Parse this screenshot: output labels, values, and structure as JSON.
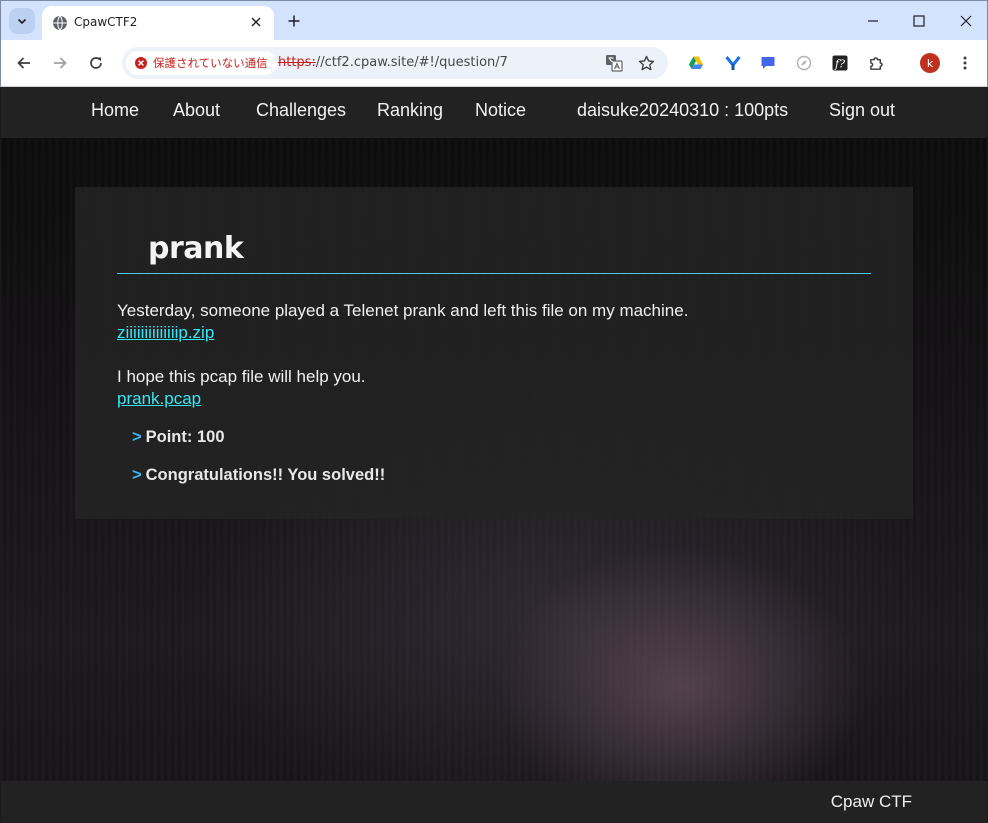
{
  "browser": {
    "tab_title": "CpawCTF2",
    "security_label": "保護されていない通信",
    "url_scheme": "https:",
    "url_rest": "//ctf2.cpaw.site/#!/question/7",
    "profile_initial": "k"
  },
  "nav": {
    "home": "Home",
    "about": "About",
    "challenges": "Challenges",
    "ranking": "Ranking",
    "notice": "Notice",
    "user": "daisuke20240310 : 100pts",
    "signout": "Sign out"
  },
  "question": {
    "title": "prank",
    "line1": "Yesterday, someone played a Telenet prank and left this file on my machine.",
    "link1": "ziiiiiiiiiiiiiip.zip",
    "line2": "I hope this pcap file will help you.",
    "link2": "prank.pcap",
    "point": "Point: 100",
    "status": "Congratulations!! You solved!!",
    "arrow": ">"
  },
  "footer": {
    "brand": "Cpaw CTF"
  }
}
